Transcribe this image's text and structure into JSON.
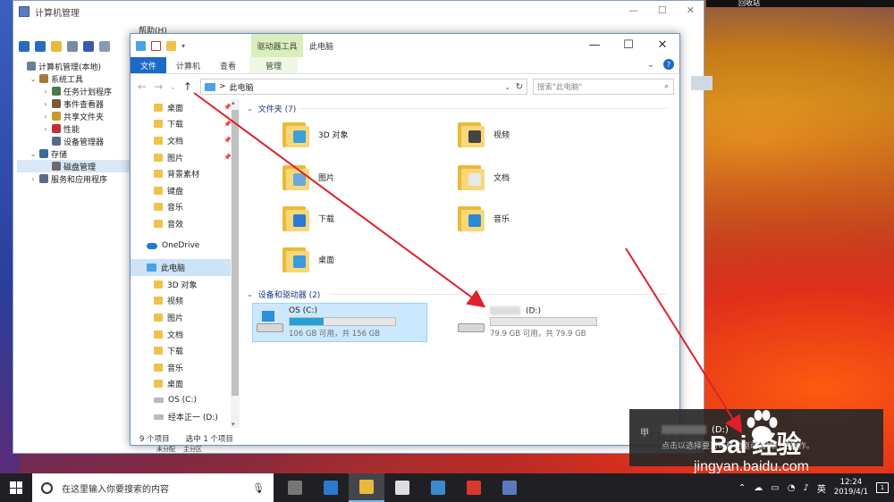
{
  "computer_management": {
    "title": "计算机管理",
    "menu_help": "帮助(H)",
    "tree": [
      {
        "label": "计算机管理(本地)",
        "level": 0,
        "arrow": "",
        "selected": false,
        "color": "#6a7f9e"
      },
      {
        "label": "系统工具",
        "level": 1,
        "arrow": "⌄",
        "selected": false,
        "color": "#a87a3a"
      },
      {
        "label": "任务计划程序",
        "level": 2,
        "arrow": "›",
        "selected": false,
        "color": "#4a7a4a"
      },
      {
        "label": "事件查看器",
        "level": 2,
        "arrow": "›",
        "selected": false,
        "color": "#7a5a3a"
      },
      {
        "label": "共享文件夹",
        "level": 2,
        "arrow": "›",
        "selected": false,
        "color": "#c99a2a"
      },
      {
        "label": "性能",
        "level": 2,
        "arrow": "›",
        "selected": false,
        "color": "#c0303a"
      },
      {
        "label": "设备管理器",
        "level": 2,
        "arrow": "",
        "selected": false,
        "color": "#5a6a8a"
      },
      {
        "label": "存储",
        "level": 1,
        "arrow": "⌄",
        "selected": false,
        "color": "#3a6aa0"
      },
      {
        "label": "磁盘管理",
        "level": 2,
        "arrow": "",
        "selected": true,
        "color": "#6a6a6a"
      },
      {
        "label": "服务和应用程序",
        "level": 1,
        "arrow": "›",
        "selected": false,
        "color": "#5a6a8a"
      }
    ],
    "bottom_labels": [
      "未分配",
      "主分区"
    ]
  },
  "explorer": {
    "title": "此电脑",
    "drive_tools_tab": "驱动器工具",
    "ribbon_tabs": [
      "文件",
      "计算机",
      "查看"
    ],
    "manage_tab": "管理",
    "address": "此电脑",
    "address_sep": ">",
    "search_placeholder": "搜索\"此电脑\"",
    "nav_items": [
      {
        "label": "桌面",
        "pinned": true,
        "type": "folder"
      },
      {
        "label": "下载",
        "pinned": true,
        "type": "folder"
      },
      {
        "label": "文档",
        "pinned": true,
        "type": "folder"
      },
      {
        "label": "图片",
        "pinned": true,
        "type": "folder"
      },
      {
        "label": "背景素材",
        "pinned": false,
        "type": "folder"
      },
      {
        "label": "键盘",
        "pinned": false,
        "type": "folder"
      },
      {
        "label": "音乐",
        "pinned": false,
        "type": "folder"
      },
      {
        "label": "音效",
        "pinned": false,
        "type": "folder"
      },
      {
        "label": "OneDrive",
        "pinned": false,
        "type": "onedrive"
      },
      {
        "label": "此电脑",
        "pinned": false,
        "type": "pc",
        "selected": true
      },
      {
        "label": "3D 对象",
        "pinned": false,
        "type": "folder"
      },
      {
        "label": "视频",
        "pinned": false,
        "type": "folder"
      },
      {
        "label": "图片",
        "pinned": false,
        "type": "folder"
      },
      {
        "label": "文档",
        "pinned": false,
        "type": "folder"
      },
      {
        "label": "下载",
        "pinned": false,
        "type": "folder"
      },
      {
        "label": "音乐",
        "pinned": false,
        "type": "folder"
      },
      {
        "label": "桌面",
        "pinned": false,
        "type": "folder"
      },
      {
        "label": "OS (C:)",
        "pinned": false,
        "type": "drive"
      },
      {
        "label": "经本正一 (D:)",
        "pinned": false,
        "type": "drive"
      }
    ],
    "folders_header": "文件夹 (7)",
    "folders": [
      {
        "label": "3D 对象",
        "badge": "#3aa0d8"
      },
      {
        "label": "视频",
        "badge": "#444"
      },
      {
        "label": "图片",
        "badge": "#6aa9d8"
      },
      {
        "label": "文档",
        "badge": "#e8e8e8"
      },
      {
        "label": "下载",
        "badge": "#2a7ad0"
      },
      {
        "label": "音乐",
        "badge": "#2a8ad8"
      },
      {
        "label": "桌面",
        "badge": "#3a9ae0"
      }
    ],
    "devices_header": "设备和驱动器 (2)",
    "drives": [
      {
        "name": "OS (C:)",
        "free": "106 GB 可用，共 156 GB",
        "used_fraction": 0.32,
        "selected": true
      },
      {
        "name": "(D:)",
        "free": "79.9 GB 可用，共 79.9 GB",
        "used_fraction": 0.0,
        "selected": false
      }
    ],
    "status_count": "9 个项目",
    "status_selected": "选中 1 个项目"
  },
  "toast": {
    "icon": "甲",
    "title": "(D:)",
    "body": "点击以选择要对可移动驱动器执行的操作。"
  },
  "watermark": {
    "logo": "Bai  经验",
    "url": "jingyan.baidu.com"
  },
  "taskbar": {
    "search_placeholder": "在这里输入你要搜索的内容",
    "apps": [
      {
        "name": "task-view",
        "color": "#777"
      },
      {
        "name": "edge",
        "color": "#2a7ad0"
      },
      {
        "name": "file-explorer",
        "color": "#e9b93a",
        "active": true
      },
      {
        "name": "mail",
        "color": "#ddd"
      },
      {
        "name": "store",
        "color": "#3a8ad0"
      },
      {
        "name": "app-red",
        "color": "#d83a2a"
      },
      {
        "name": "computer-management",
        "color": "#5a7ac0"
      }
    ],
    "ime": "英",
    "time": "12:24",
    "date": "2019/4/1",
    "notif_count": "1"
  },
  "desktop": {
    "corner_text": "回收站"
  }
}
